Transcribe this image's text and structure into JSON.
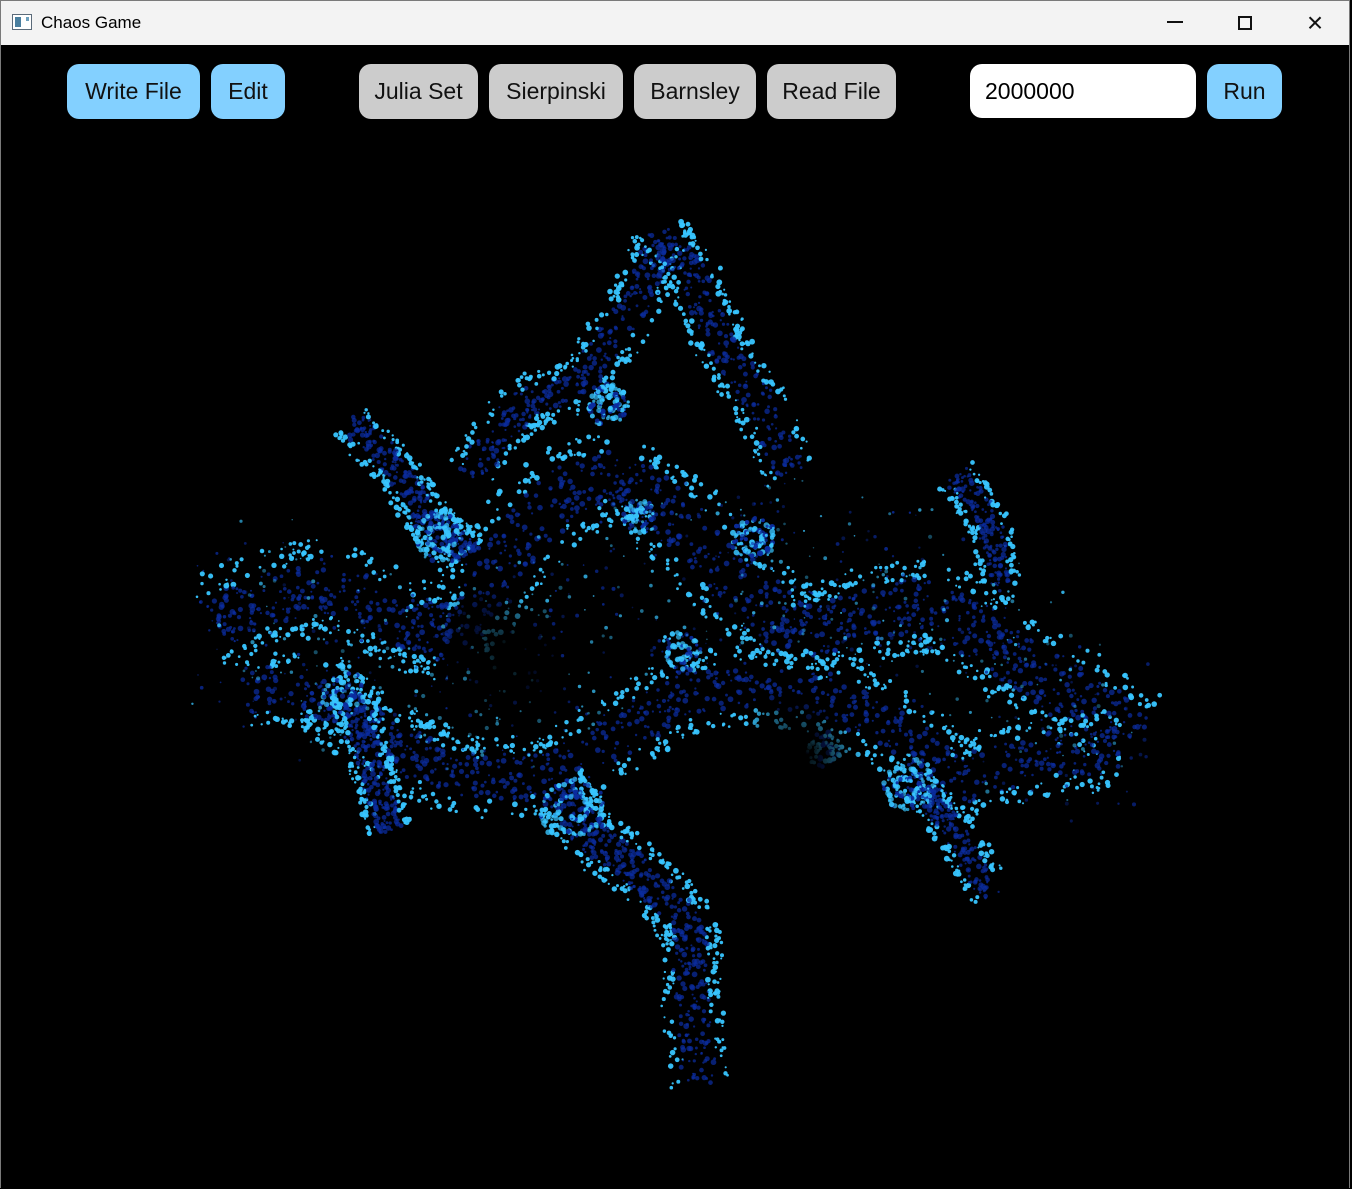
{
  "window": {
    "title": "Chaos Game",
    "controls": [
      "minimize",
      "maximize",
      "close"
    ]
  },
  "toolbar": {
    "write_file": "Write File",
    "edit": "Edit",
    "julia_set": "Julia Set",
    "sierpinski": "Sierpinski",
    "barnsley": "Barnsley",
    "read_file": "Read File",
    "iterations": "2000000",
    "run": "Run"
  },
  "colors": {
    "background": "#000000",
    "accent_button": "#83d0ff",
    "secondary_button": "#cccccc",
    "fractal_bright": "#38c5ff",
    "fractal_dark": "#0b2c9f"
  },
  "visualization": {
    "type": "Julia set fractal"
  }
}
